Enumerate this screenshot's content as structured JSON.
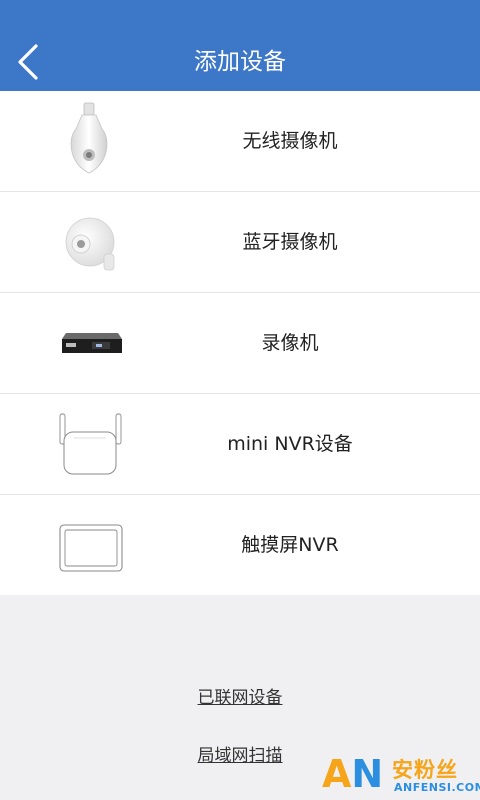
{
  "header": {
    "title": "添加设备",
    "back_icon": "chevron-left-icon",
    "bg_color": "#3d77c7"
  },
  "devices": [
    {
      "label": "无线摄像机",
      "icon": "bulb-camera-icon"
    },
    {
      "label": "蓝牙摄像机",
      "icon": "ball-camera-icon"
    },
    {
      "label": "录像机",
      "icon": "dvr-recorder-icon"
    },
    {
      "label": "mini NVR设备",
      "icon": "mini-nvr-icon"
    },
    {
      "label": "触摸屏NVR",
      "icon": "touchscreen-nvr-icon"
    }
  ],
  "links": {
    "connected": "已联网设备",
    "lan_scan": "局域网扫描"
  },
  "watermark": {
    "an": "AN",
    "cn": "安粉丝",
    "en": "ANFENSI.COM"
  }
}
